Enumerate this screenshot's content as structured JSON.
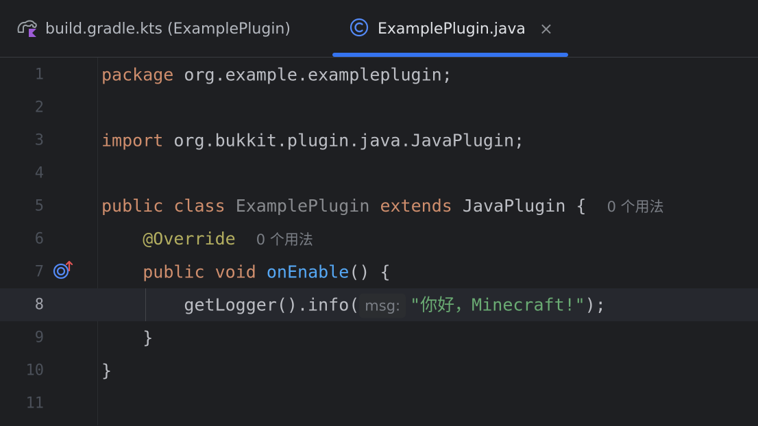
{
  "tabs": [
    {
      "label": "build.gradle.kts (ExamplePlugin)",
      "icon": "gradle-kotlin-icon",
      "active": false
    },
    {
      "label": "ExamplePlugin.java",
      "icon": "java-class-icon",
      "active": true,
      "close": "×"
    }
  ],
  "colors": {
    "accent": "#3574f0",
    "keyword": "#cf8e6d",
    "function": "#56a8f5",
    "annotation": "#b3ae60",
    "string": "#6aab73"
  },
  "editor": {
    "current_line": 8,
    "gutter_icon": "overrides-method-icon",
    "lines": {
      "l1": {
        "num": "1",
        "kw": "package",
        "rest": " org.example.exampleplugin;"
      },
      "l2": {
        "num": "2"
      },
      "l3": {
        "num": "3",
        "kw": "import",
        "rest": " org.bukkit.plugin.java.JavaPlugin;"
      },
      "l4": {
        "num": "4"
      },
      "l5": {
        "num": "5",
        "kw1": "public",
        "kw2": "class",
        "cls": "ExamplePlugin",
        "kw3": "extends",
        "sup": "JavaPlugin",
        "brace": " {",
        "hint": "0 个用法"
      },
      "l6": {
        "num": "6",
        "ann": "@Override",
        "hint": "0 个用法"
      },
      "l7": {
        "num": "7",
        "kw1": "public",
        "kw2": "void",
        "fn": "onEnable",
        "rest": "() {"
      },
      "l8": {
        "num": "8",
        "call": "getLogger().info(",
        "param": "msg:",
        "str": "\"你好，Minecraft!\"",
        "end": ");"
      },
      "l9": {
        "num": "9",
        "text": "}"
      },
      "l10": {
        "num": "10",
        "text": "}"
      },
      "l11": {
        "num": "11"
      }
    }
  }
}
